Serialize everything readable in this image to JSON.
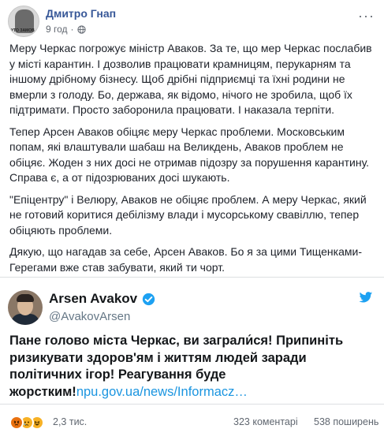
{
  "post": {
    "author": "Дмитро Гнап",
    "time": "9 год",
    "time_separator": "·",
    "avatar_caption": "УТО ЗАМОВ",
    "more_label": "···",
    "paragraphs": [
      "Меру Черкас погрожує міністр Аваков. За те, що мер Черкас послабив у місті карантин. І дозволив працювати крамницям, перукарням та іншому дрібному бізнесу. Щоб дрібні підприємці та їхні родини не вмерли з голоду. Бо, держава, як відомо, нічого не зробила, щоб їх підтримати. Просто заборонила працювати. І наказала терпіти.",
      "Тепер Арсен Аваков обіцяє меру Черкас проблеми. Московським попам, які влаштували шабаш на Великдень, Аваков проблем не обіцяє. Жоден з них досі не отримав підозру за порушення карантину. Справа є, а от підозрюваних досі шукають.",
      "\"Епіцентру\" і Велюру, Аваков не обіцяє проблем. А меру Черкас, який не готовий коритися дебілізму влади і мусорському свавіллю, тепер обіцяють проблеми.",
      "Дякую, що нагадав за себе, Арсен Аваков. Бо я за цими Тищенками-Герегами вже став забувати, який ти чорт."
    ]
  },
  "tweet": {
    "name": "Arsen Avakov",
    "handle": "@AvakovArsen",
    "text": "Пане голово міста Черкас, ви заграли́ся! Припиніть ризикувати здоров'ям і життям людей заради політичних ігор! Реагування буде жорстким!",
    "link": "npu.gov.ua/news/Informacz…"
  },
  "footer": {
    "reactions_count": "2,3 тис.",
    "comments": "323 коментарі",
    "shares": "538 поширень"
  },
  "colors": {
    "author_link": "#385898",
    "twitter_blue": "#1da1f2",
    "tweet_link": "#1b95e0"
  },
  "icons": [
    "globe-icon",
    "more-icon",
    "verified-icon",
    "twitter-bird-icon",
    "angry-reaction-icon",
    "sad-reaction-icon",
    "haha-reaction-icon"
  ]
}
